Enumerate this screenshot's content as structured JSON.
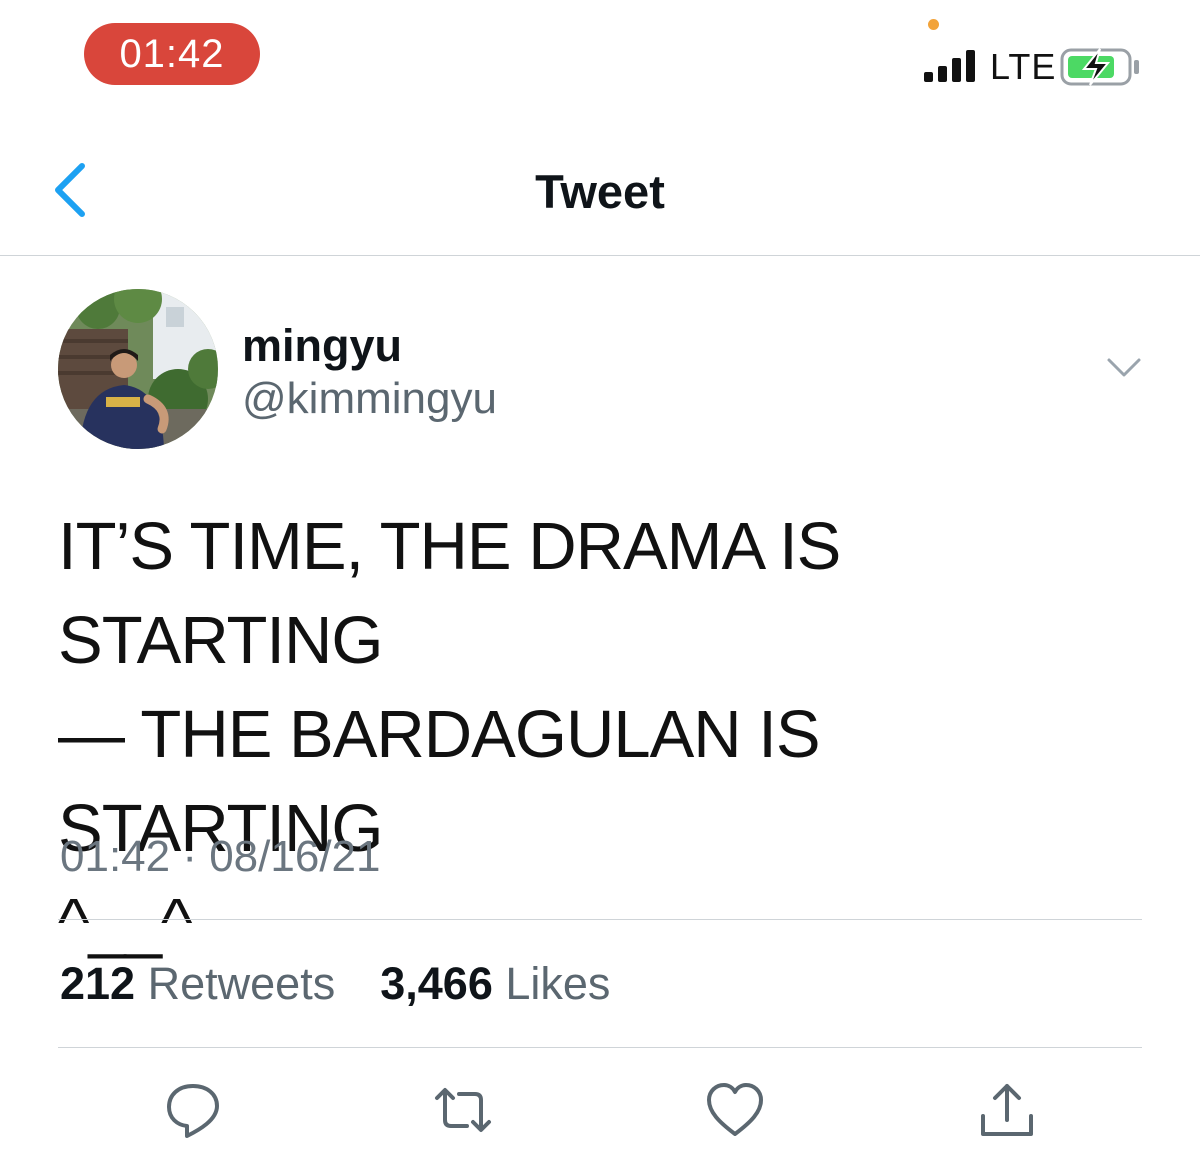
{
  "status_bar": {
    "time": "01:42",
    "carrier": "LTE",
    "pill_color": "#d9463b",
    "indicator_color": "#f2a33a",
    "battery_color": "#4cd964"
  },
  "nav": {
    "back_icon": "chevron-left-icon",
    "title": "Tweet",
    "accent_color": "#1da1f2"
  },
  "tweet": {
    "display_name": "mingyu",
    "handle": "@kimmingyu",
    "text": "IT’S TIME, THE DRAMA IS STARTING\n— THE BARDAGULAN IS STARTING\n^__^",
    "timestamp": "01:42 · 08/16/21",
    "retweets_count": "212",
    "retweets_label": "Retweets",
    "likes_count": "3,466",
    "likes_label": "Likes"
  },
  "actions": [
    {
      "icon": "reply-icon"
    },
    {
      "icon": "retweet-icon"
    },
    {
      "icon": "like-icon"
    },
    {
      "icon": "share-icon"
    }
  ]
}
